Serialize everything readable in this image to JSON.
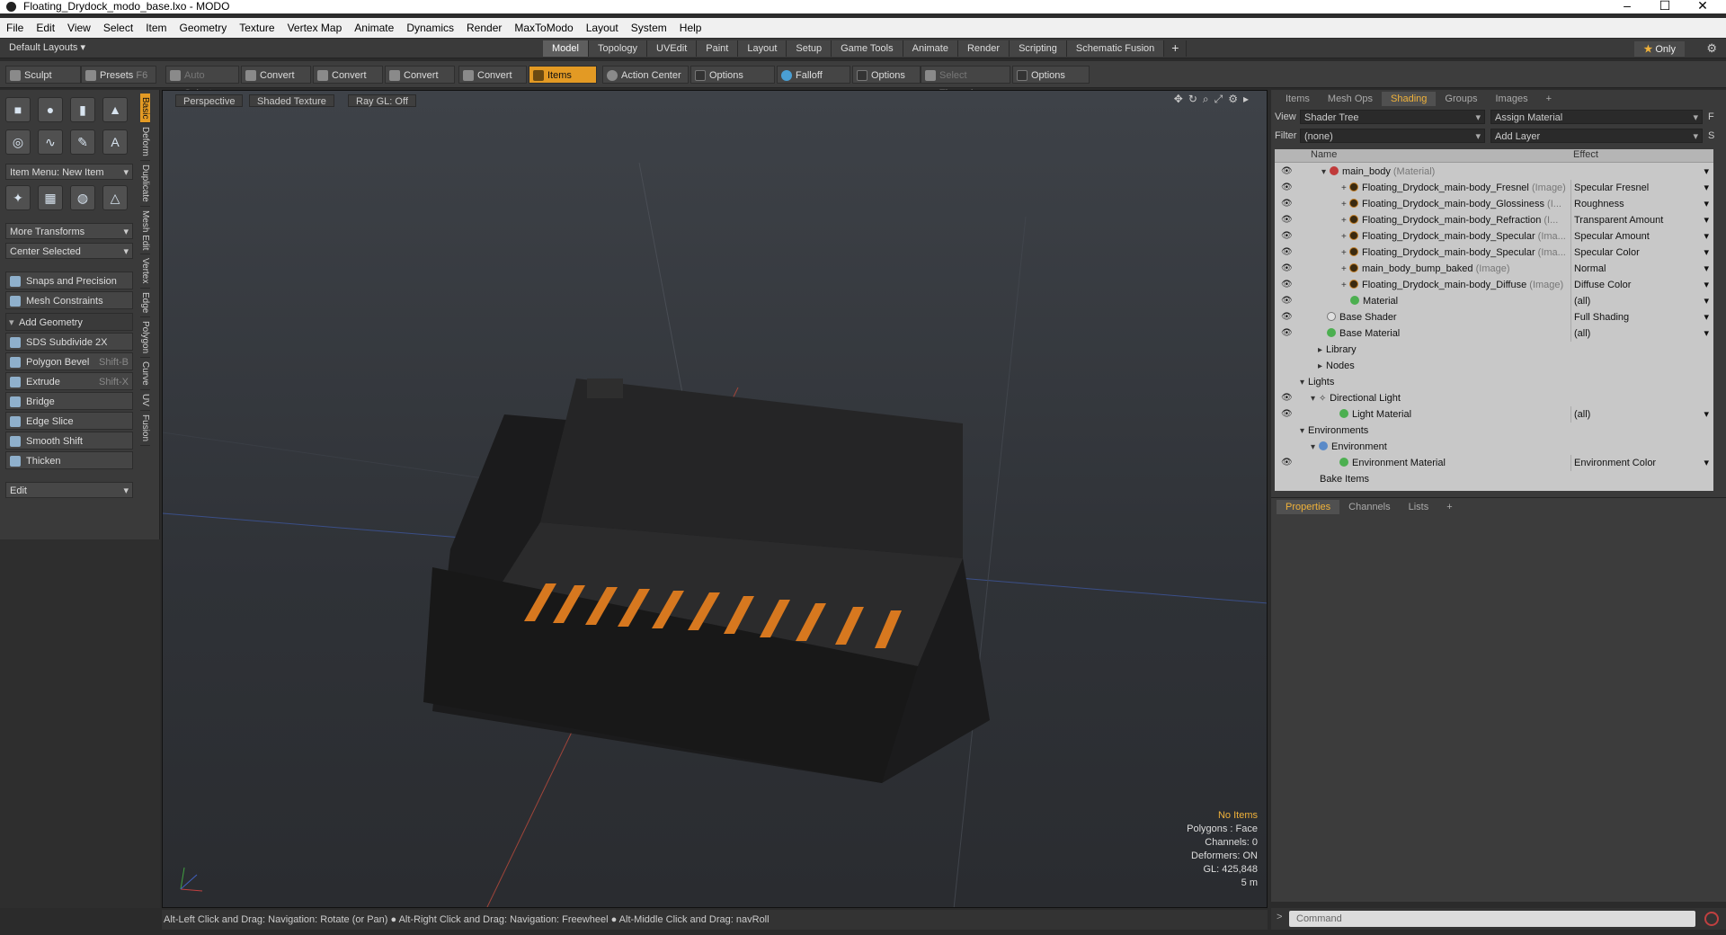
{
  "window": {
    "title": "Floating_Drydock_modo_base.lxo - MODO"
  },
  "menu": [
    "File",
    "Edit",
    "View",
    "Select",
    "Item",
    "Geometry",
    "Texture",
    "Vertex Map",
    "Animate",
    "Dynamics",
    "Render",
    "MaxToModo",
    "Layout",
    "System",
    "Help"
  ],
  "layout_bar": {
    "default_layouts": "Default Layouts",
    "tabs": [
      "Model",
      "Topology",
      "UVEdit",
      "Paint",
      "Layout",
      "Setup",
      "Game Tools",
      "Animate",
      "Render",
      "Scripting",
      "Schematic Fusion"
    ],
    "active_tab": "Model",
    "add": "+",
    "only": "Only"
  },
  "toolbar": {
    "sculpt": "Sculpt",
    "presets": "Presets",
    "presets_key": "F6",
    "auto_select": "Auto Select",
    "convert1": "Convert",
    "convert2": "Convert",
    "convert3": "Convert",
    "convert4": "Convert",
    "items": "Items",
    "action_center": "Action Center",
    "options1": "Options",
    "falloff": "Falloff",
    "options2": "Options",
    "select_through": "Select Through",
    "options3": "Options"
  },
  "left_panel": {
    "item_menu": "Item Menu: New Item",
    "more_transforms": "More Transforms",
    "center_selected": "Center Selected",
    "snaps": "Snaps and Precision",
    "mesh_constraints": "Mesh Constraints",
    "add_geometry": "Add Geometry",
    "tools": [
      {
        "label": "SDS Subdivide 2X",
        "shortcut": ""
      },
      {
        "label": "Polygon Bevel",
        "shortcut": "Shift-B"
      },
      {
        "label": "Extrude",
        "shortcut": "Shift-X"
      },
      {
        "label": "Bridge",
        "shortcut": ""
      },
      {
        "label": "Edge Slice",
        "shortcut": ""
      },
      {
        "label": "Smooth Shift",
        "shortcut": ""
      },
      {
        "label": "Thicken",
        "shortcut": ""
      }
    ],
    "edit": "Edit",
    "vtabs": [
      "Basic",
      "Deform",
      "Duplicate",
      "Mesh Edit",
      "Vertex",
      "Edge",
      "Polygon",
      "Curve",
      "UV",
      "Fusion"
    ]
  },
  "viewport": {
    "view": "Perspective",
    "shading": "Shaded Texture",
    "raygl": "Ray GL: Off",
    "stats": {
      "items": "No Items",
      "polygons": "Polygons : Face",
      "channels": "Channels: 0",
      "deformers": "Deformers: ON",
      "gl": "GL: 425,848",
      "scale": "5 m"
    }
  },
  "statusbar": "Alt-Left Click and Drag: Navigation: Rotate (or Pan) ● Alt-Right Click and Drag: Navigation: Freewheel ● Alt-Middle Click and Drag: navRoll",
  "right_panel": {
    "tabs": [
      "Items",
      "Mesh Ops",
      "Shading",
      "Groups",
      "Images",
      "+"
    ],
    "active_tab": "Shading",
    "view_label": "View",
    "view_value": "Shader Tree",
    "assign_material": "Assign Material",
    "f_btn": "F",
    "filter_label": "Filter",
    "filter_value": "(none)",
    "add_layer": "Add Layer",
    "s_btn": "S",
    "col_name": "Name",
    "col_effect": "Effect",
    "rows": [
      {
        "name": "main_body",
        "tag": "(Material)",
        "effect": ""
      },
      {
        "name": "Floating_Drydock_main-body_Fresnel",
        "tag": "(Image)",
        "effect": "Specular Fresnel"
      },
      {
        "name": "Floating_Drydock_main-body_Glossiness",
        "tag": "(I...",
        "effect": "Roughness"
      },
      {
        "name": "Floating_Drydock_main-body_Refraction",
        "tag": "(I...",
        "effect": "Transparent Amount"
      },
      {
        "name": "Floating_Drydock_main-body_Specular",
        "tag": "(Ima...",
        "effect": "Specular Amount"
      },
      {
        "name": "Floating_Drydock_main-body_Specular",
        "tag": "(Ima...",
        "effect": "Specular Color"
      },
      {
        "name": "main_body_bump_baked",
        "tag": "(Image)",
        "effect": "Normal"
      },
      {
        "name": "Floating_Drydock_main-body_Diffuse",
        "tag": "(Image)",
        "effect": "Diffuse Color"
      },
      {
        "name": "Material",
        "tag": "",
        "effect": "(all)"
      },
      {
        "name": "Base Shader",
        "tag": "",
        "effect": "Full Shading"
      },
      {
        "name": "Base Material",
        "tag": "",
        "effect": "(all)"
      },
      {
        "name": "Library",
        "tag": "",
        "effect": ""
      },
      {
        "name": "Nodes",
        "tag": "",
        "effect": ""
      },
      {
        "name": "Lights",
        "tag": "",
        "effect": ""
      },
      {
        "name": "Directional Light",
        "tag": "",
        "effect": ""
      },
      {
        "name": "Light Material",
        "tag": "",
        "effect": "(all)"
      },
      {
        "name": "Environments",
        "tag": "",
        "effect": ""
      },
      {
        "name": "Environment",
        "tag": "",
        "effect": ""
      },
      {
        "name": "Environment Material",
        "tag": "",
        "effect": "Environment Color"
      },
      {
        "name": "Bake Items",
        "tag": "",
        "effect": ""
      }
    ],
    "props_tabs": [
      "Properties",
      "Channels",
      "Lists",
      "+"
    ],
    "props_active": "Properties",
    "command_placeholder": "Command"
  },
  "colors": {
    "accent": "#e39a24",
    "viewport_bg": "#33363b"
  }
}
